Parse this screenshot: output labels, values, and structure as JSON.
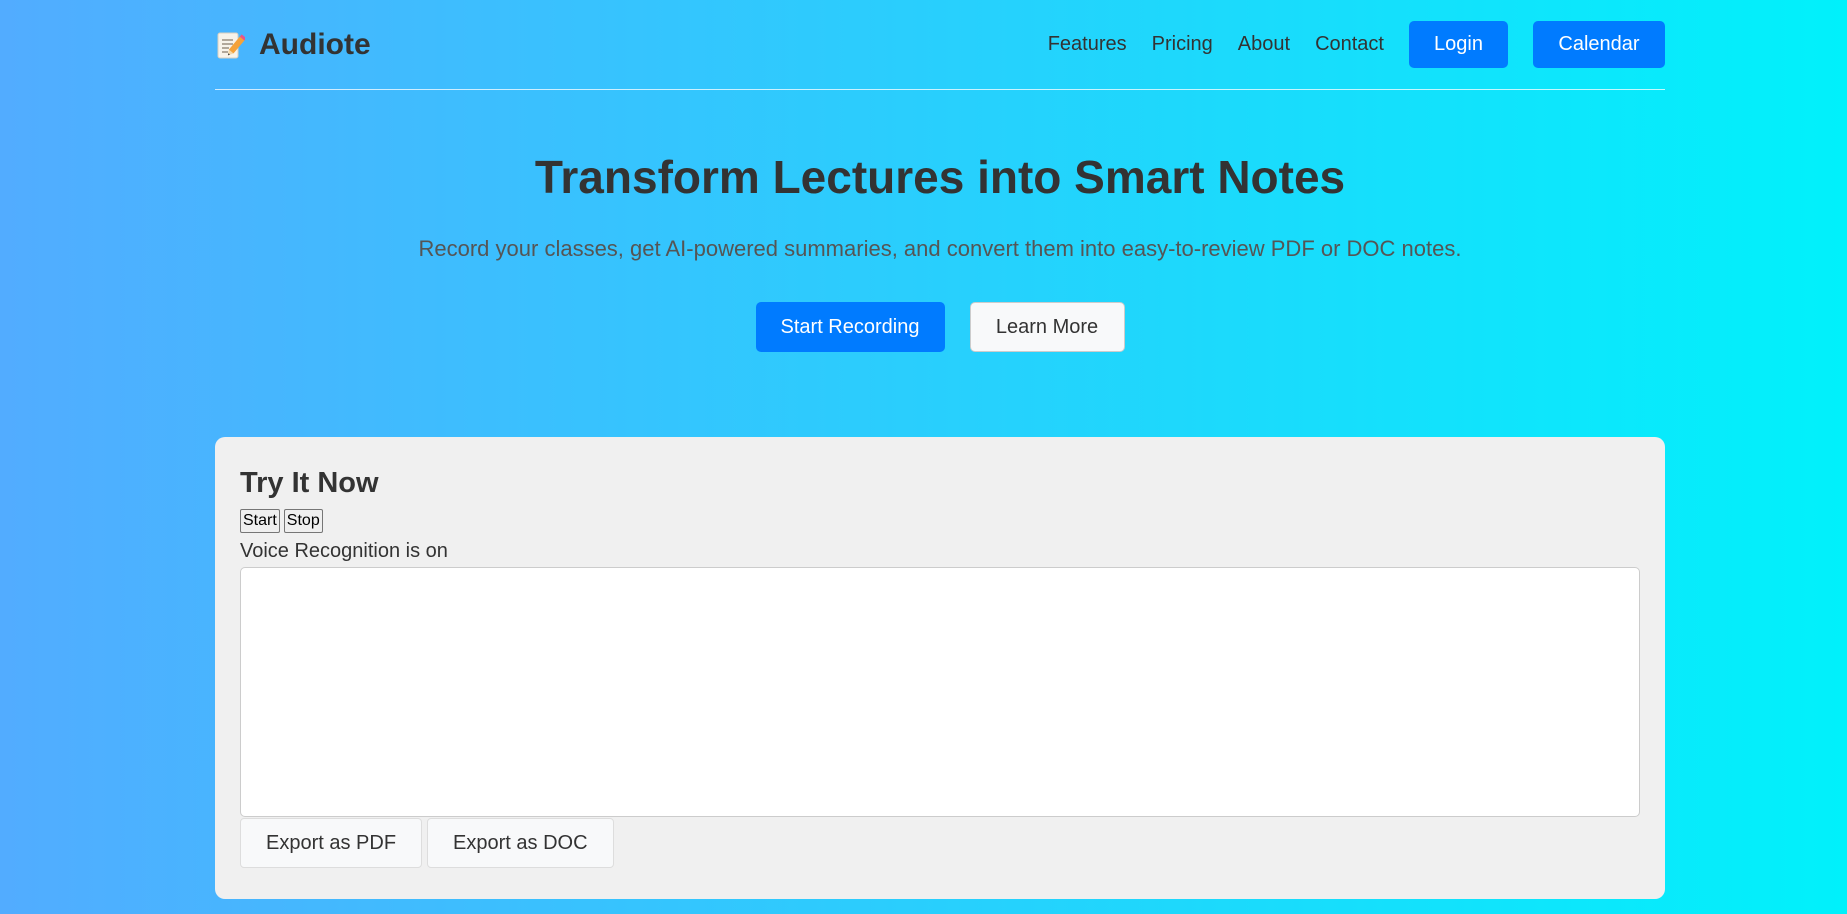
{
  "brand": {
    "name": "Audiote",
    "icon": "memo-pencil-icon"
  },
  "nav": {
    "links": [
      "Features",
      "Pricing",
      "About",
      "Contact"
    ],
    "login_label": "Login",
    "calendar_label": "Calendar"
  },
  "hero": {
    "title": "Transform Lectures into Smart Notes",
    "subtitle": "Record your classes, get AI-powered summaries, and convert them into easy-to-review PDF or DOC notes.",
    "start_label": "Start Recording",
    "learn_label": "Learn More"
  },
  "demo": {
    "title": "Try It Now",
    "start_label": "Start",
    "stop_label": "Stop",
    "status": "Voice Recognition is on",
    "transcript_value": "",
    "export_pdf_label": "Export as PDF",
    "export_doc_label": "Export as DOC"
  },
  "colors": {
    "gradient_start": "#52acff",
    "gradient_end": "#00f1fb",
    "accent": "#007bff",
    "panel_bg": "#f0f0f0",
    "text": "#333333"
  }
}
